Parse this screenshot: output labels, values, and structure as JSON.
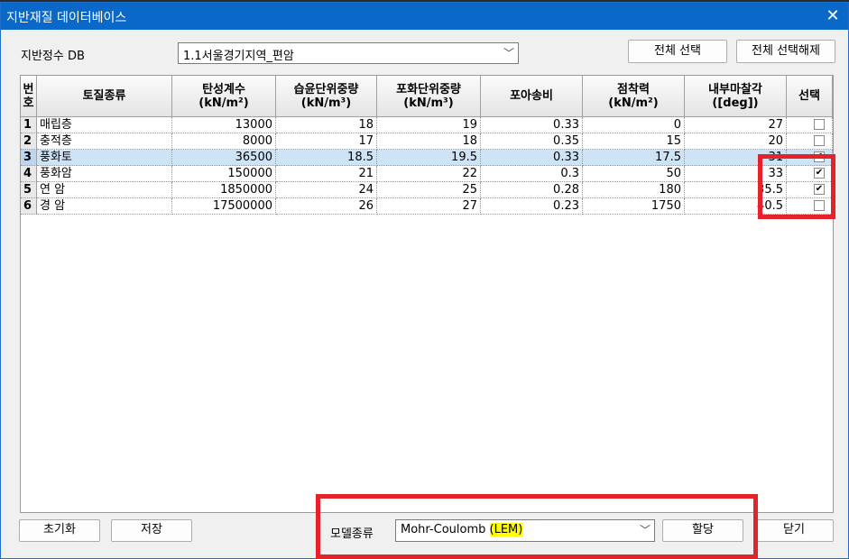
{
  "window": {
    "title": "지반재질 데이터베이스",
    "close_glyph": "✕"
  },
  "db": {
    "label": "지반정수 DB",
    "selected": "1.1서울경기지역_편암",
    "arrow": "﹀"
  },
  "buttons": {
    "select_all": "전체 선택",
    "deselect_all": "전체 선택해제",
    "reset": "초기화",
    "save": "저장",
    "assign": "할당",
    "close": "닫기"
  },
  "table": {
    "headers": [
      {
        "l1": "번",
        "l2": "호"
      },
      {
        "l1": "토질종류",
        "l2": ""
      },
      {
        "l1": "탄성계수",
        "l2": "(kN/m²)"
      },
      {
        "l1": "습윤단위중량",
        "l2": "(kN/m³)"
      },
      {
        "l1": "포화단위중량",
        "l2": "(kN/m³)"
      },
      {
        "l1": "포아송비",
        "l2": ""
      },
      {
        "l1": "점착력",
        "l2": "(kN/m²)"
      },
      {
        "l1": "내부마찰각",
        "l2": "([deg])"
      },
      {
        "l1": "선택",
        "l2": ""
      }
    ],
    "rows": [
      {
        "no": "1",
        "type": "매립층",
        "e": "13000",
        "wet": "18",
        "sat": "19",
        "poisson": "0.33",
        "coh": "0",
        "phi": "27",
        "checked": false,
        "check_glyph": ""
      },
      {
        "no": "2",
        "type": "충적층",
        "e": "8000",
        "wet": "17",
        "sat": "18",
        "poisson": "0.35",
        "coh": "15",
        "phi": "20",
        "checked": false,
        "check_glyph": ""
      },
      {
        "no": "3",
        "type": "풍화토",
        "e": "36500",
        "wet": "18.5",
        "sat": "19.5",
        "poisson": "0.33",
        "coh": "17.5",
        "phi": "31",
        "checked": true,
        "check_glyph": "✔"
      },
      {
        "no": "4",
        "type": "풍화암",
        "e": "150000",
        "wet": "21",
        "sat": "22",
        "poisson": "0.3",
        "coh": "50",
        "phi": "33",
        "checked": true,
        "check_glyph": "✔"
      },
      {
        "no": "5",
        "type": "연 암",
        "e": "1850000",
        "wet": "24",
        "sat": "25",
        "poisson": "0.28",
        "coh": "180",
        "phi": "35.5",
        "checked": true,
        "check_glyph": "✔"
      },
      {
        "no": "6",
        "type": "경 암",
        "e": "17500000",
        "wet": "26",
        "sat": "27",
        "poisson": "0.23",
        "coh": "1750",
        "phi": "40.5",
        "checked": false,
        "check_glyph": ""
      }
    ],
    "selected_row": 3
  },
  "model": {
    "label": "모델종류",
    "value_main": "Mohr-Coulomb ",
    "value_highlight": "(LEM)",
    "arrow": "﹀"
  },
  "colors": {
    "titlebar": "#0a68c8",
    "selection": "#cfe3f7",
    "annotation_red": "#e3222a",
    "highlight": "#ffff00"
  }
}
